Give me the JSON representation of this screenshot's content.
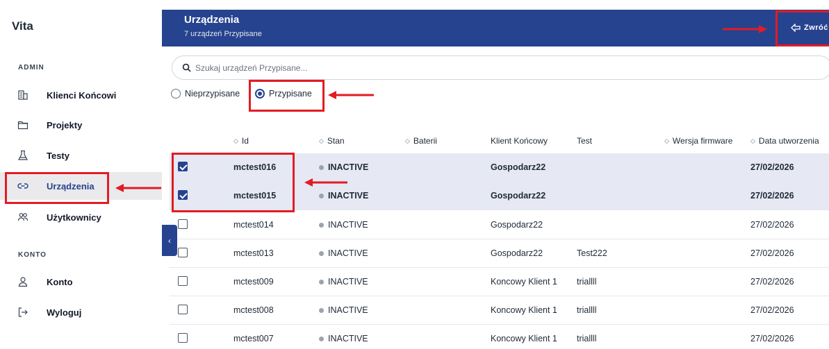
{
  "app": {
    "brand": "Vita"
  },
  "sidebar": {
    "admin_label": "ADMIN",
    "konto_label": "KONTO",
    "items": [
      {
        "label": "Klienci Końcowi",
        "icon": "building-icon"
      },
      {
        "label": "Projekty",
        "icon": "folder-icon"
      },
      {
        "label": "Testy",
        "icon": "flask-icon"
      },
      {
        "label": "Urządzenia",
        "icon": "link-icon",
        "active": true
      },
      {
        "label": "Użytkownicy",
        "icon": "users-icon"
      },
      {
        "label": "Konto",
        "icon": "user-icon"
      },
      {
        "label": "Wyloguj",
        "icon": "logout-icon"
      }
    ]
  },
  "header": {
    "title": "Urządzenia",
    "subtitle": "7 urządzeń Przypisane",
    "back_label": "Zwróć"
  },
  "search": {
    "placeholder": "Szukaj urządzeń Przypisane..."
  },
  "filters": {
    "unassigned_label": "Nieprzypisane",
    "assigned_label": "Przypisane",
    "selected": "Przypisane"
  },
  "table": {
    "columns": [
      "Id",
      "Stan",
      "Baterii",
      "Klient Końcowy",
      "Test",
      "Wersja firmware",
      "Data utworzenia"
    ],
    "rows": [
      {
        "id": "mctest016",
        "status": "INACTIVE",
        "battery": "",
        "client": "Gospodarz22",
        "test": "",
        "firmware": "",
        "created": "27/02/2026",
        "checked": true
      },
      {
        "id": "mctest015",
        "status": "INACTIVE",
        "battery": "",
        "client": "Gospodarz22",
        "test": "",
        "firmware": "",
        "created": "27/02/2026",
        "checked": true
      },
      {
        "id": "mctest014",
        "status": "INACTIVE",
        "battery": "",
        "client": "Gospodarz22",
        "test": "",
        "firmware": "",
        "created": "27/02/2026",
        "checked": false
      },
      {
        "id": "mctest013",
        "status": "INACTIVE",
        "battery": "",
        "client": "Gospodarz22",
        "test": "Test222",
        "firmware": "",
        "created": "27/02/2026",
        "checked": false
      },
      {
        "id": "mctest009",
        "status": "INACTIVE",
        "battery": "",
        "client": "Koncowy Klient 1",
        "test": "triallll",
        "firmware": "",
        "created": "27/02/2026",
        "checked": false
      },
      {
        "id": "mctest008",
        "status": "INACTIVE",
        "battery": "",
        "client": "Koncowy Klient 1",
        "test": "triallll",
        "firmware": "",
        "created": "27/02/2026",
        "checked": false
      },
      {
        "id": "mctest007",
        "status": "INACTIVE",
        "battery": "",
        "client": "Koncowy Klient 1",
        "test": "triallll",
        "firmware": "",
        "created": "27/02/2026",
        "checked": false
      }
    ]
  },
  "colors": {
    "primary": "#26438f",
    "annotation": "#e31b23",
    "selected_row": "#e6e9f4"
  }
}
